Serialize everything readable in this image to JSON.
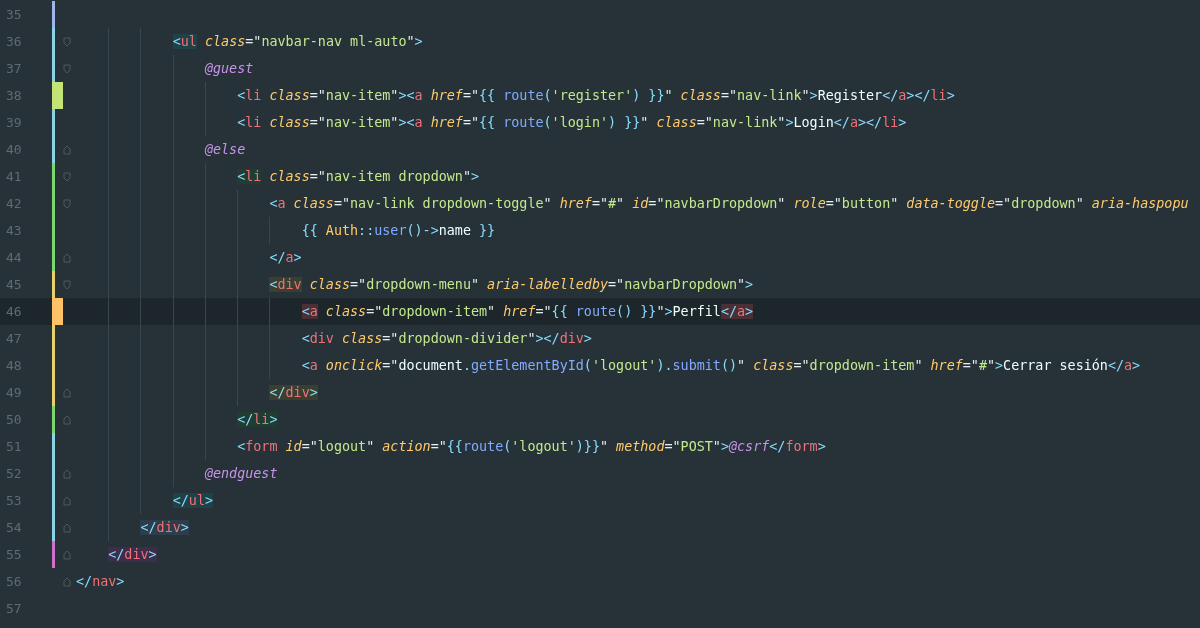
{
  "editor": {
    "lines": [
      {
        "number": "35",
        "marker": {
          "color": "#9fb4e8",
          "wide": false
        }
      },
      {
        "number": "36",
        "fold_start": true,
        "marker": {
          "color": "#8ad4e6",
          "wide": false
        },
        "bracket_match": {
          "color": "#1f4148"
        },
        "code": "            <ul class=\"navbar-nav ml-auto\">"
      },
      {
        "number": "37",
        "fold_start": true,
        "marker": {
          "color": "#8ad4e6",
          "wide": false
        },
        "code": "                @guest"
      },
      {
        "number": "38",
        "marker": {
          "color": "#c5e478",
          "wide": true
        },
        "code": "                    <li class=\"nav-item\"><a href=\"{{ route('register') }}\" class=\"nav-link\">Register</a></li>"
      },
      {
        "number": "39",
        "marker": {
          "color": "#8ad4e6",
          "wide": false
        },
        "code": "                    <li class=\"nav-item\"><a href=\"{{ route('login') }}\" class=\"nav-link\">Login</a></li>"
      },
      {
        "number": "40",
        "fold_end": true,
        "marker": {
          "color": "#8ad4e6",
          "wide": false
        },
        "code": "                @else"
      },
      {
        "number": "41",
        "fold_start": true,
        "marker": {
          "color": "#7ed66f",
          "wide": false
        },
        "bracket_match": {
          "color": "#1f3d31"
        },
        "code": "                    <li class=\"nav-item dropdown\">"
      },
      {
        "number": "42",
        "fold_start": true,
        "marker": {
          "color": "#7ed66f",
          "wide": false
        },
        "code": "                        <a class=\"nav-link dropdown-toggle\" href=\"#\" id=\"navbarDropdown\" role=\"button\" data-toggle=\"dropdown\" aria-haspopu"
      },
      {
        "number": "43",
        "marker": {
          "color": "#7ed66f",
          "wide": false
        },
        "code": "                            {{ Auth::user()->name }}"
      },
      {
        "number": "44",
        "fold_end": true,
        "marker": {
          "color": "#7ed66f",
          "wide": false
        },
        "code": "                        </a>"
      },
      {
        "number": "45",
        "fold_start": true,
        "marker": {
          "color": "#e8d06a",
          "wide": false
        },
        "bracket_match": {
          "color": "#3a3f30"
        },
        "code": "                        <div class=\"dropdown-menu\" aria-labelledby=\"navbarDropdown\">"
      },
      {
        "number": "46",
        "current": true,
        "marker": {
          "color": "#ffc266",
          "wide": true
        },
        "bracket_match": {
          "color": "#4a2f35"
        },
        "code": "                            <a class=\"dropdown-item\" href=\"{{ route() }}\">Perfil</a>"
      },
      {
        "number": "47",
        "marker": {
          "color": "#e8d06a",
          "wide": false
        },
        "code": "                            <div class=\"dropdown-divider\"></div>"
      },
      {
        "number": "48",
        "marker": {
          "color": "#e8d06a",
          "wide": false
        },
        "code": "                            <a onclick=\"document.getElementById('logout').submit()\" class=\"dropdown-item\" href=\"#\">Cerrar sesión</a>"
      },
      {
        "number": "49",
        "fold_end": true,
        "marker": {
          "color": "#e8d06a",
          "wide": false
        },
        "bracket_match": {
          "color": "#3a3f30"
        },
        "code": "                        </div>"
      },
      {
        "number": "50",
        "fold_end": true,
        "marker": {
          "color": "#7ed66f",
          "wide": false
        },
        "bracket_match": {
          "color": "#1f3d31"
        },
        "code": "                    </li>"
      },
      {
        "number": "51",
        "marker": {
          "color": "#8ad4e6",
          "wide": false
        },
        "code": "                    <form id=\"logout\" action=\"{{route('logout')}}\" method=\"POST\">@csrf</form>"
      },
      {
        "number": "52",
        "fold_end": true,
        "marker": {
          "color": "#8ad4e6",
          "wide": false
        },
        "code": "                @endguest"
      },
      {
        "number": "53",
        "fold_end": true,
        "marker": {
          "color": "#8ad4e6",
          "wide": false
        },
        "bracket_match": {
          "color": "#1f4148"
        },
        "code": "            </ul>"
      },
      {
        "number": "54",
        "fold_end": true,
        "marker": {
          "color": "#8ad4e6",
          "wide": false
        },
        "bracket_match": {
          "color": "#2e3d4b"
        },
        "code": "        </div>"
      },
      {
        "number": "55",
        "fold_end": true,
        "marker": {
          "color": "#d070c8",
          "wide": false
        },
        "bracket_match": {
          "color": "#3c2d4a"
        },
        "code": "    </div>"
      },
      {
        "number": "56",
        "fold_end": true,
        "code": "</nav>"
      },
      {
        "number": "57"
      }
    ]
  }
}
